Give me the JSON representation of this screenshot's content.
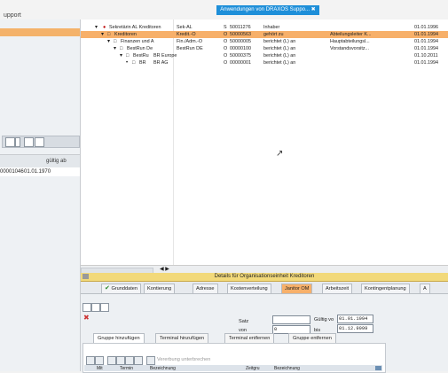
{
  "menu": {
    "support_label": "upport"
  },
  "banner": {
    "text": "Anwendungen von DRAXOS Suppo... ✖"
  },
  "left_pane": {
    "grid_header": "gültig ab",
    "grid_row": {
      "id": "00001046",
      "date": "01.01.1970"
    }
  },
  "tree": {
    "rows": [
      {
        "name": "Sekretärin AL Kreditoren",
        "short": "Sek-AL",
        "type": "S",
        "id": "50011276",
        "relation": "Inhaber",
        "extra": "",
        "date": "01.01.1996"
      },
      {
        "name": "Kreditoren",
        "short": "Kredit.-O",
        "type": "O",
        "id": "50000563",
        "relation": "gehört zu",
        "extra": "Abteilungsleiter K...",
        "date": "01.01.1994"
      },
      {
        "name": "Finanzen und A",
        "short": "Fin./Adm.-O",
        "type": "O",
        "id": "50000005",
        "relation": "berichtet (L) an",
        "extra": "Hauptabteilungsl...",
        "date": "01.01.1994"
      },
      {
        "name": "BestRun De",
        "short": "BestRun DE",
        "type": "O",
        "id": "00000100",
        "relation": "berichtet (L) an",
        "extra": "Vorstandsvorsitz...",
        "date": "01.01.1994"
      },
      {
        "name": "BestRu",
        "short": "BR Europe",
        "type": "O",
        "id": "50000375",
        "relation": "berichtet (L) an",
        "extra": "",
        "date": "01.10.2011"
      },
      {
        "name": "BR",
        "short": "BR AG",
        "type": "O",
        "id": "00000001",
        "relation": "berichtet (L) an",
        "extra": "",
        "date": "01.01.1994"
      }
    ]
  },
  "details": {
    "title": "Details für Organisationseinheit Kreditoren",
    "tabs": [
      {
        "label": "Grunddaten",
        "checked": true
      },
      {
        "label": "Kontierung",
        "checked": false
      },
      {
        "label": "Adresse",
        "checked": false
      },
      {
        "label": "Kostenverteilung",
        "checked": false
      },
      {
        "label": "Janitor OM",
        "checked": false,
        "active": true
      },
      {
        "label": "Arbeitszeit",
        "checked": false
      },
      {
        "label": "Kontingentplanung",
        "checked": false
      },
      {
        "label": "A",
        "checked": false
      }
    ],
    "satz_label": "Satz",
    "satz_value": "",
    "gueltig_label": "Gültig vo",
    "gueltig_value": "01.01.1994",
    "von_label": "von",
    "von_value": "0",
    "bis_label": "bis",
    "bis_value": "01.12.9999",
    "subtabs": [
      "Gruppe hinzufügen",
      "Terminal hinzufügen",
      "Terminal entfernen",
      "Gruppe entfernen"
    ],
    "vererbung_label": "Vererbung unterbrechen",
    "grid_headers": [
      "Mit",
      "Termin",
      "Bezeichnung",
      "Zeitgru",
      "Bezeichnung"
    ]
  },
  "colors": {
    "selected_row": "#f7b06a",
    "banner": "#1e8fd9",
    "details_title": "#f2d97a"
  }
}
